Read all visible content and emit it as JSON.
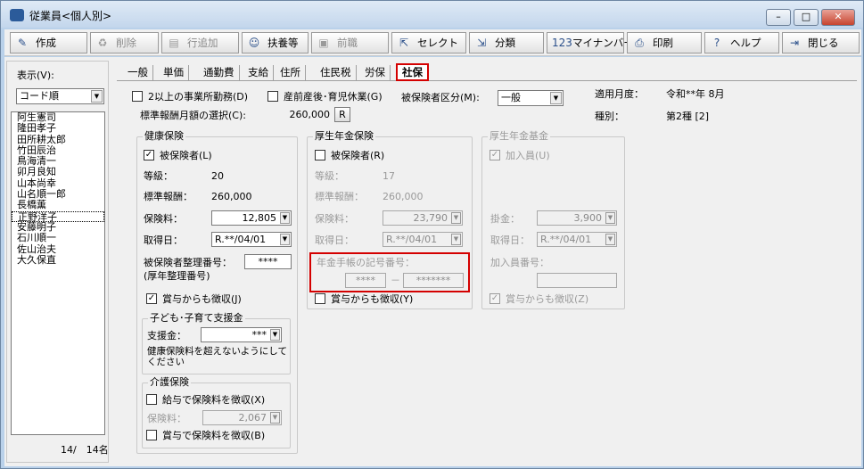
{
  "window": {
    "title": "従業員<個人別>",
    "min": "–",
    "max": "□",
    "close": "✕"
  },
  "toolbar": [
    {
      "label": "作成",
      "icon": "✎",
      "name": "create"
    },
    {
      "label": "削除",
      "icon": "♻",
      "name": "delete",
      "disabled": true
    },
    {
      "label": "行追加",
      "icon": "▤",
      "name": "add-row",
      "disabled": true
    },
    {
      "label": "扶養等",
      "icon": "☺",
      "name": "dependents"
    },
    {
      "label": "前職",
      "icon": "▣",
      "name": "previous-job",
      "disabled": true
    },
    {
      "label": "セレクト",
      "icon": "⇱",
      "name": "select"
    },
    {
      "label": "分類",
      "icon": "⇲",
      "name": "classify"
    },
    {
      "label": "マイナンバー",
      "icon": "123",
      "name": "mynumber"
    },
    {
      "label": "印刷",
      "icon": "⎙",
      "name": "print"
    },
    {
      "label": "ヘルプ",
      "icon": "?",
      "name": "help"
    },
    {
      "label": "閉じる",
      "icon": "⇥",
      "name": "close"
    }
  ],
  "left": {
    "display_label": "表示(V):",
    "order_value": "コード順",
    "employees": [
      "阿生憲司",
      "隆田孝子",
      "田所耕太郎",
      "竹田辰治",
      "鳥海清一",
      "卯月良知",
      "山本尚幸",
      "山名順一郎",
      "長橋薫",
      "正野洋子",
      "安藤明子",
      "石川順一",
      "佐山治夫",
      "大久保直"
    ],
    "selected_index": 9,
    "count": "14/　14名"
  },
  "tabs": [
    "一般",
    "単価",
    "通勤費",
    "支給",
    "住所",
    "住民税",
    "労保",
    "社保"
  ],
  "top": {
    "multi_office": "2以上の事業所勤務(D)",
    "maternity_leave": "産前産後･育児休業(G)",
    "insured_class_label": "被保険者区分(M):",
    "insured_class_value": "一般",
    "apply_month_label": "適用月度：",
    "apply_month_value": "令和**年 8月",
    "type_label": "種別：",
    "type_value": "第2種 [2]",
    "std_select_label": "標準報酬月額の選択(C):",
    "std_select_value": "260,000",
    "std_select_btn": "R"
  },
  "health": {
    "title": "健康保険",
    "insured": "被保険者(L)",
    "grade_label": "等級：",
    "grade_value": "20",
    "std_label": "標準報酬：",
    "std_value": "260,000",
    "premium_label": "保険料：",
    "premium_value": "12,805",
    "acquired_label": "取得日：",
    "acquired_value": "R.**/04/01",
    "number_label": "被保険者整理番号：",
    "number_label2": "(厚年整理番号)",
    "number_value": "****",
    "bonus": "賞与からも徴収(J)"
  },
  "child": {
    "title": "子ども･子育て支援金",
    "support_label": "支援金：",
    "support_value": "***",
    "note": "健康保険料を超えないようにしてください"
  },
  "care": {
    "title": "介護保険",
    "from_salary": "給与で保険料を徴収(X)",
    "premium_label": "保険料：",
    "premium_value": "2,067",
    "from_bonus": "賞与で保険料を徴収(B)"
  },
  "pension": {
    "title": "厚生年金保険",
    "insured": "被保険者(R)",
    "grade_label": "等級：",
    "grade_value": "17",
    "std_label": "標準報酬：",
    "std_value": "260,000",
    "premium_label": "保険料：",
    "premium_value": "23,790",
    "acquired_label": "取得日：",
    "acquired_value": "R.**/04/01",
    "book_label": "年金手帳の記号番号：",
    "book_value1": "****",
    "book_dash": "－",
    "book_value2": "*******",
    "bonus": "賞与からも徴収(Y)"
  },
  "fund": {
    "title": "厚生年金基金",
    "member": "加入員(U)",
    "premium_label": "掛金：",
    "premium_value": "3,900",
    "acquired_label": "取得日：",
    "acquired_value": "R.**/04/01",
    "member_no_label": "加入員番号：",
    "bonus": "賞与からも徴収(Z)"
  }
}
